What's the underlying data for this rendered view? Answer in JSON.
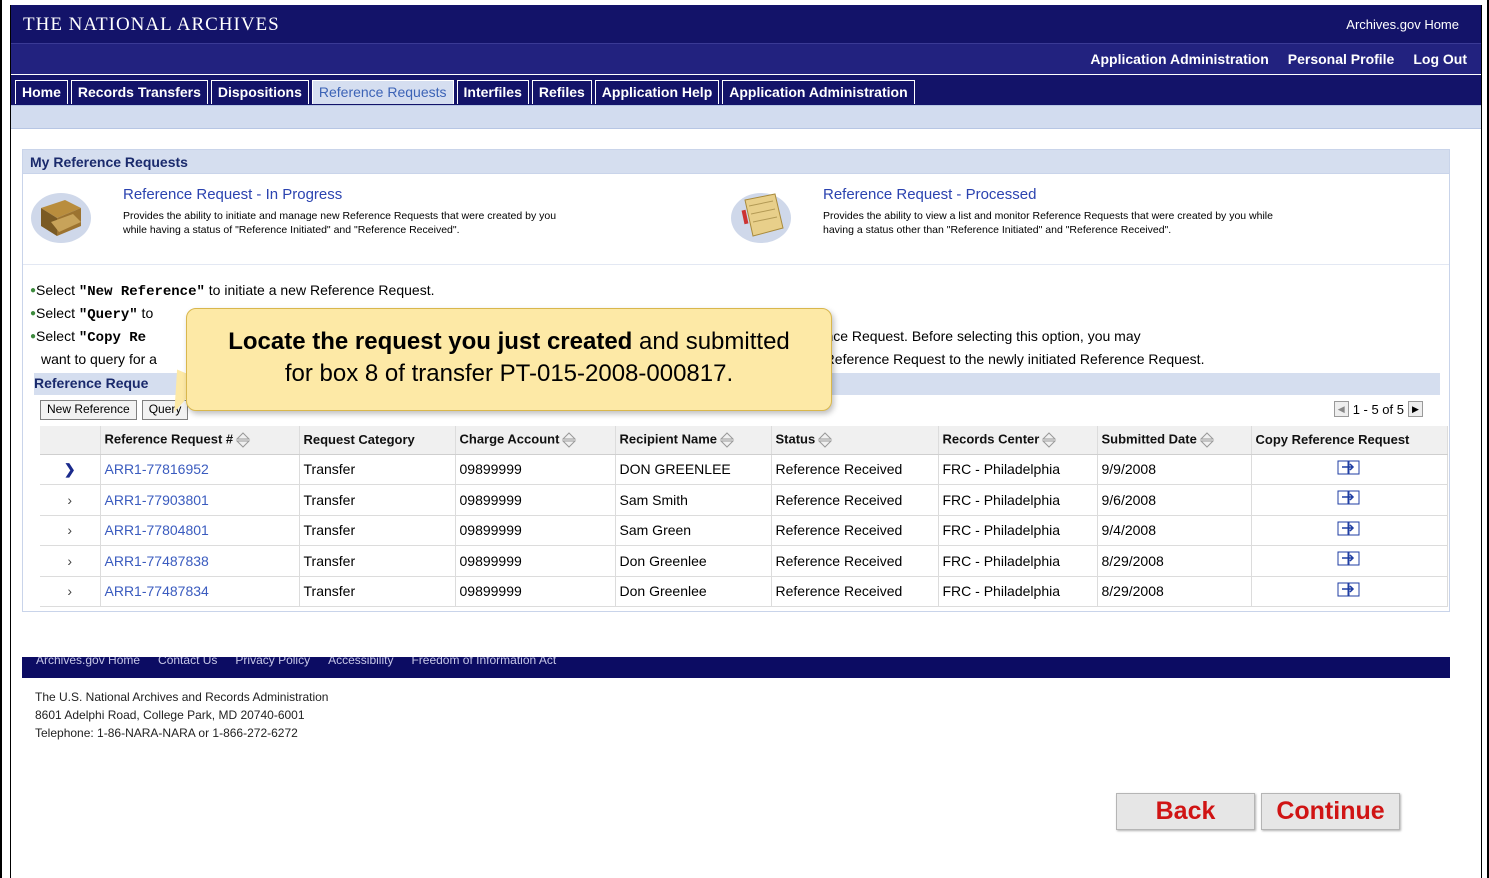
{
  "header": {
    "title": "THE NATIONAL ARCHIVES",
    "home_link": "Archives.gov Home",
    "user_links": [
      "Application Administration",
      "Personal Profile",
      "Log Out"
    ]
  },
  "tabs": [
    {
      "label": "Home",
      "active": false
    },
    {
      "label": "Records Transfers",
      "active": false
    },
    {
      "label": "Dispositions",
      "active": false
    },
    {
      "label": "Reference Requests",
      "active": true
    },
    {
      "label": "Interfiles",
      "active": false
    },
    {
      "label": "Refiles",
      "active": false
    },
    {
      "label": "Application Help",
      "active": false
    },
    {
      "label": "Application Administration",
      "active": false
    }
  ],
  "panel": {
    "title": "My Reference Requests",
    "options": [
      {
        "link": "Reference Request - In Progress",
        "desc1": "Provides the ability to initiate and manage new Reference Requests that were created by you",
        "desc2": "while having a status of \"Reference Initiated\" and \"Reference Received\"."
      },
      {
        "link": "Reference Request - Processed",
        "desc1": "Provides the ability to view a list and monitor Reference Requests that were created by you while",
        "desc2": "having a status other than \"Reference Initiated\" and \"Reference Received\"."
      }
    ],
    "instructions": {
      "line1_pre": "Select ",
      "line1_bold": "\"New Reference\"",
      "line1_post": " to initiate a new Reference Request.",
      "line2_pre": "Select ",
      "line2_bold": "\"Query\"",
      "line2_post": " to",
      "line3_pre": "Select ",
      "line3_bold": "\"Copy Re",
      "line3_right": "rence Request. Before selecting this option, you may",
      "line4_left": "want to query for a",
      "line4_right": "d Reference Request to the newly initiated Reference Request."
    },
    "section_title": "Reference Reque",
    "buttons": {
      "new_reference": "New Reference",
      "query": "Query"
    },
    "pager": "1 - 5 of 5"
  },
  "table": {
    "columns": [
      "Reference Request #",
      "Request Category",
      "Charge Account",
      "Recipient Name",
      "Status",
      "Records Center",
      "Submitted Date",
      "Copy Reference Request"
    ],
    "rows": [
      {
        "ref": "ARR1-77816952",
        "category": "Transfer",
        "account": "09899999",
        "recipient": "DON GREENLEE",
        "status": "Reference Received",
        "center": "FRC - Philadelphia",
        "date": "9/9/2008",
        "selected": true
      },
      {
        "ref": "ARR1-77903801",
        "category": "Transfer",
        "account": "09899999",
        "recipient": "Sam Smith",
        "status": "Reference Received",
        "center": "FRC - Philadelphia",
        "date": "9/6/2008",
        "selected": false
      },
      {
        "ref": "ARR1-77804801",
        "category": "Transfer",
        "account": "09899999",
        "recipient": "Sam Green",
        "status": "Reference Received",
        "center": "FRC - Philadelphia",
        "date": "9/4/2008",
        "selected": false
      },
      {
        "ref": "ARR1-77487838",
        "category": "Transfer",
        "account": "09899999",
        "recipient": "Don Greenlee",
        "status": "Reference Received",
        "center": "FRC - Philadelphia",
        "date": "8/29/2008",
        "selected": false
      },
      {
        "ref": "ARR1-77487834",
        "category": "Transfer",
        "account": "09899999",
        "recipient": "Don Greenlee",
        "status": "Reference Received",
        "center": "FRC - Philadelphia",
        "date": "8/29/2008",
        "selected": false
      }
    ]
  },
  "callout": {
    "bold": "Locate the request you just created",
    "rest1": " and submitted",
    "line2": "for box 8 of transfer PT-015-2008-000817."
  },
  "footer": {
    "links": [
      "Archives.gov Home",
      "Contact Us",
      "Privacy Policy",
      "Accessibility",
      "Freedom of Information Act"
    ],
    "address": [
      "The U.S. National Archives and Records Administration",
      "8601 Adelphi Road, College Park, MD 20740-6001",
      "Telephone: 1-86-NARA-NARA or 1-866-272-6272"
    ]
  },
  "nav": {
    "back": "Back",
    "continue": "Continue"
  },
  "colors": {
    "navy": "#131369",
    "light_blue": "#d5deef",
    "link": "#3a5bbf",
    "callout": "#fde9a6",
    "nav_text": "#d01414"
  },
  "icons": {
    "copy": "copy-request-icon",
    "row_arrow": "chevron-right-icon",
    "sort": "sort-arrows-icon"
  }
}
